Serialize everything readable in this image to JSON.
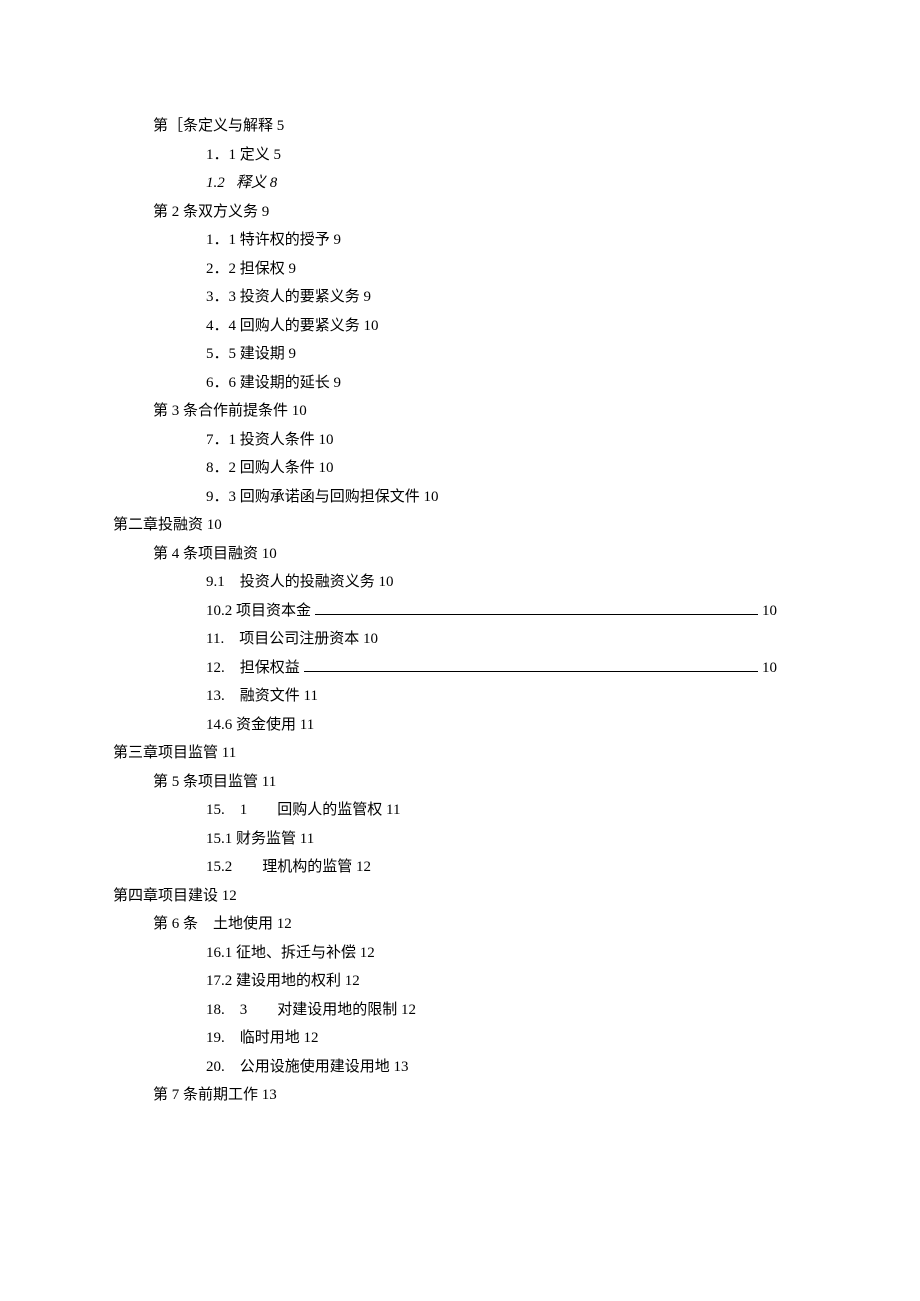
{
  "lines": {
    "l1": "第［条定义与解释 5",
    "l2": "1．1 定义 5",
    "l3_label": "1.2",
    "l3_text": "释义 8",
    "l4": "第 2 条双方义务 9",
    "l5": "1．1 特许权的授予 9",
    "l6": "2．2 担保权 9",
    "l7": "3．3 投资人的要紧义务 9",
    "l8": "4．4 回购人的要紧义务 10",
    "l9": "5．5 建设期 9",
    "l10": "6．6 建设期的延长 9",
    "l11": "第 3 条合作前提条件 10",
    "l12": "7．1 投资人条件 10",
    "l13": "8．2 回购人条件 10",
    "l14": "9．3 回购承诺函与回购担保文件 10",
    "l15": "第二章投融资 10",
    "l16": "第 4 条项目融资 10",
    "l17": "9.1　投资人的投融资义务 10",
    "l18_label": "10.2 项目资本金",
    "l18_pg": "10",
    "l19": "11.　项目公司注册资本 10",
    "l20_label": "12.　担保权益",
    "l20_pg": "10",
    "l21": "13.　融资文件 11",
    "l22": "14.6 资金使用 11",
    "l23": "第三章项目监管 11",
    "l24": "第 5 条项目监管 11",
    "l25": "15.　1　　回购人的监管权 11",
    "l26": "15.1 财务监管 11",
    "l27": "15.2　　理机构的监管 12",
    "l28": "第四章项目建设 12",
    "l29": "第 6 条　土地使用 12",
    "l30": "16.1 征地、拆迁与补偿 12",
    "l31": "17.2 建设用地的权利 12",
    "l32": "18.　3　　对建设用地的限制 12",
    "l33": "19.　临时用地 12",
    "l34": "20.　公用设施使用建设用地 13",
    "l35": "第 7 条前期工作 13"
  }
}
